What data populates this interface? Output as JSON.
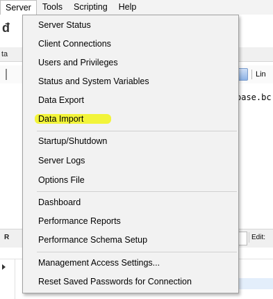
{
  "menubar": {
    "items": [
      {
        "label": "Server",
        "active": true
      },
      {
        "label": "Tools"
      },
      {
        "label": "Scripting"
      },
      {
        "label": "Help"
      }
    ]
  },
  "background": {
    "left_glyph": "đ",
    "tab_left": "ta",
    "close_glyph": "×",
    "toolbar_label": "Lin",
    "code_text": "pase.bc",
    "bottom_left": "R",
    "edit_label": "Edit:"
  },
  "server_menu": {
    "groups": [
      [
        "Server Status",
        "Client Connections",
        "Users and Privileges",
        "Status and System Variables",
        "Data Export",
        "Data Import"
      ],
      [
        "Startup/Shutdown",
        "Server Logs",
        "Options File"
      ],
      [
        "Dashboard",
        "Performance Reports",
        "Performance Schema Setup"
      ],
      [
        "Management Access Settings...",
        "Reset Saved Passwords for Connection"
      ]
    ],
    "highlighted_item": "Data Import",
    "highlight_color": "#f2f51a"
  }
}
